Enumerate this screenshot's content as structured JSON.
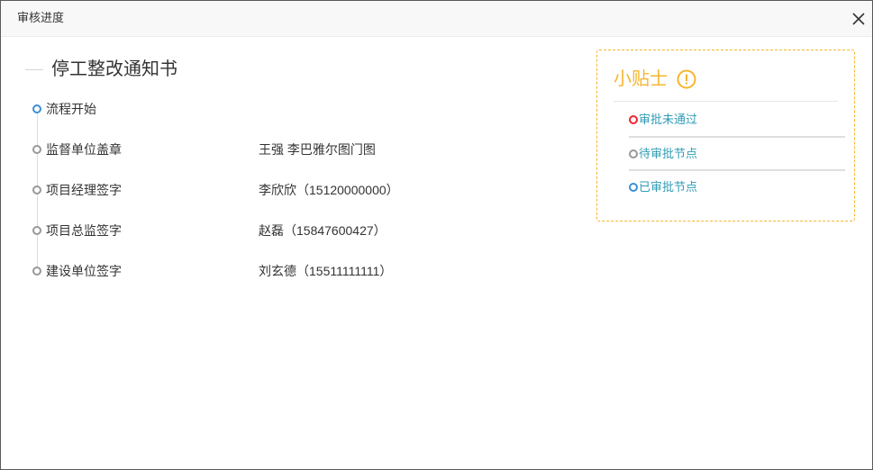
{
  "dialog": {
    "title": "审核进度",
    "close_icon": "close-icon"
  },
  "document": {
    "title": "停工整改通知书"
  },
  "timeline": [
    {
      "label": "流程开始",
      "status": "approved"
    },
    {
      "label": "监督单位盖章",
      "detail": "王强 李巴雅尔图门图",
      "status": "pending"
    },
    {
      "label": "项目经理签字",
      "detail": "李欣欣（15120000000）",
      "status": "pending"
    },
    {
      "label": "项目总监签字",
      "detail": "赵磊（15847600427）",
      "status": "pending"
    },
    {
      "label": "建设单位签字",
      "detail": "刘玄德（15511111111）",
      "status": "pending"
    }
  ],
  "tips": {
    "title": "小贴士",
    "icon": "exclamation-circle-icon",
    "legend": [
      {
        "label": "审批未通过",
        "status": "rejected"
      },
      {
        "label": "待审批节点",
        "status": "pending"
      },
      {
        "label": "已审批节点",
        "status": "approved"
      }
    ]
  },
  "status_colors": {
    "rejected": "#f5222d",
    "pending": "#999999",
    "approved": "#3d8fd6"
  },
  "theme": {
    "tips_accent": "#f4b62f",
    "legend_text": "#2f9cb5"
  }
}
